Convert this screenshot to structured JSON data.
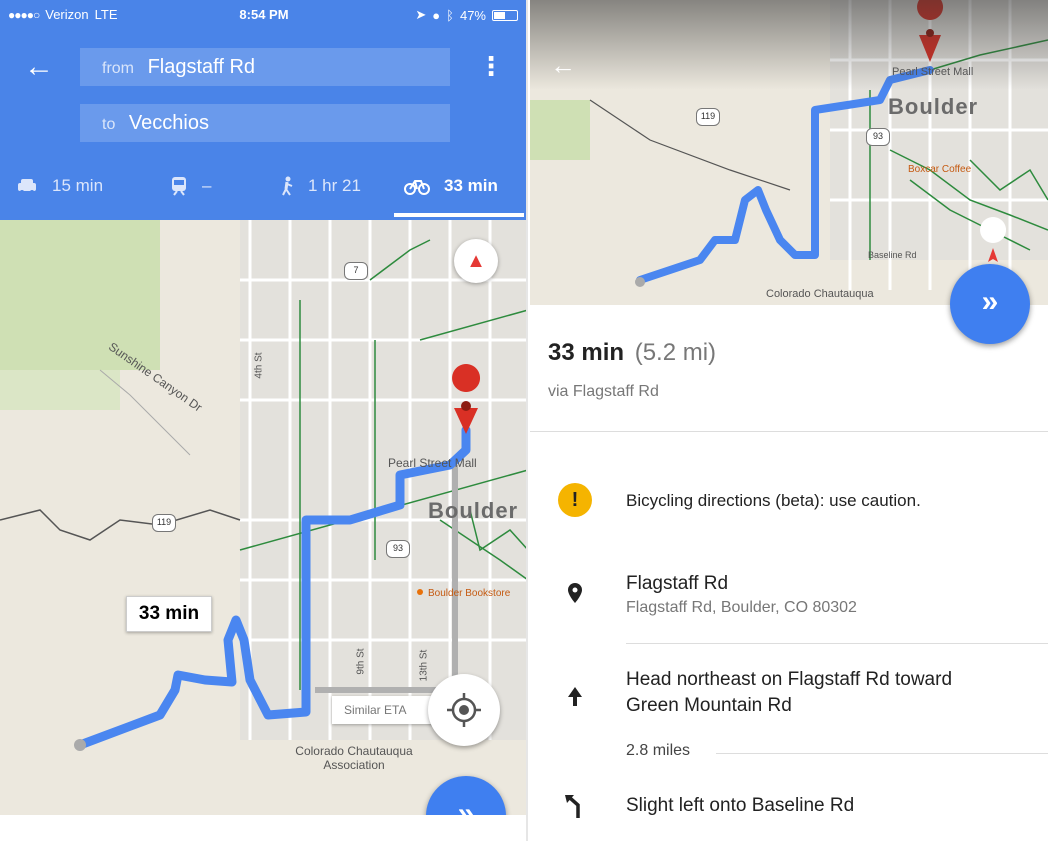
{
  "status_bar": {
    "carrier": "Verizon",
    "network": "LTE",
    "time": "8:54 PM",
    "battery": "47%"
  },
  "directions": {
    "from_prefix": "from",
    "from": "Flagstaff Rd",
    "to_prefix": "to",
    "to": "Vecchios"
  },
  "modes": {
    "car": "15 min",
    "transit": "–",
    "walk": "1 hr 21",
    "bike": "33 min"
  },
  "map_left": {
    "eta_bubble": "33 min",
    "similar_eta": "Similar ETA",
    "city": "Boulder",
    "labels": {
      "sunshine": "Sunshine Canyon Dr",
      "pearl": "Pearl Street Mall",
      "chautauqua": "Colorado Chautauqua Association",
      "fourth_st": "4th St",
      "ninth_st": "9th St",
      "twelfth_st": "13th St",
      "bookstore": "Boulder Bookstore"
    },
    "shields": [
      "7",
      "119",
      "93"
    ]
  },
  "map_right": {
    "city": "Boulder",
    "labels": {
      "pearl": "Pearl Street Mall",
      "chautauqua": "Colorado Chautauqua",
      "baseline": "Baseline Rd",
      "bookstore": "Boxcar Coffee"
    },
    "shields": [
      "119",
      "93"
    ]
  },
  "summary": {
    "time": "33 min",
    "distance": "(5.2 mi)",
    "via": "via Flagstaff Rd"
  },
  "steps": {
    "warning": "Bicycling directions (beta): use caution.",
    "start_title": "Flagstaff Rd",
    "start_address": "Flagstaff Rd, Boulder, CO 80302",
    "step1_line1": "Head northeast on Flagstaff Rd toward",
    "step1_line2": "Green Mountain Rd",
    "step1_distance": "2.8 miles",
    "step2": "Slight left onto Baseline Rd"
  },
  "colors": {
    "header_blue": "#4a84e8",
    "route_blue": "#4a86f0",
    "fab_blue": "#3f7ff0",
    "warning_yellow": "#f5b400",
    "pin_red": "#d93025"
  }
}
